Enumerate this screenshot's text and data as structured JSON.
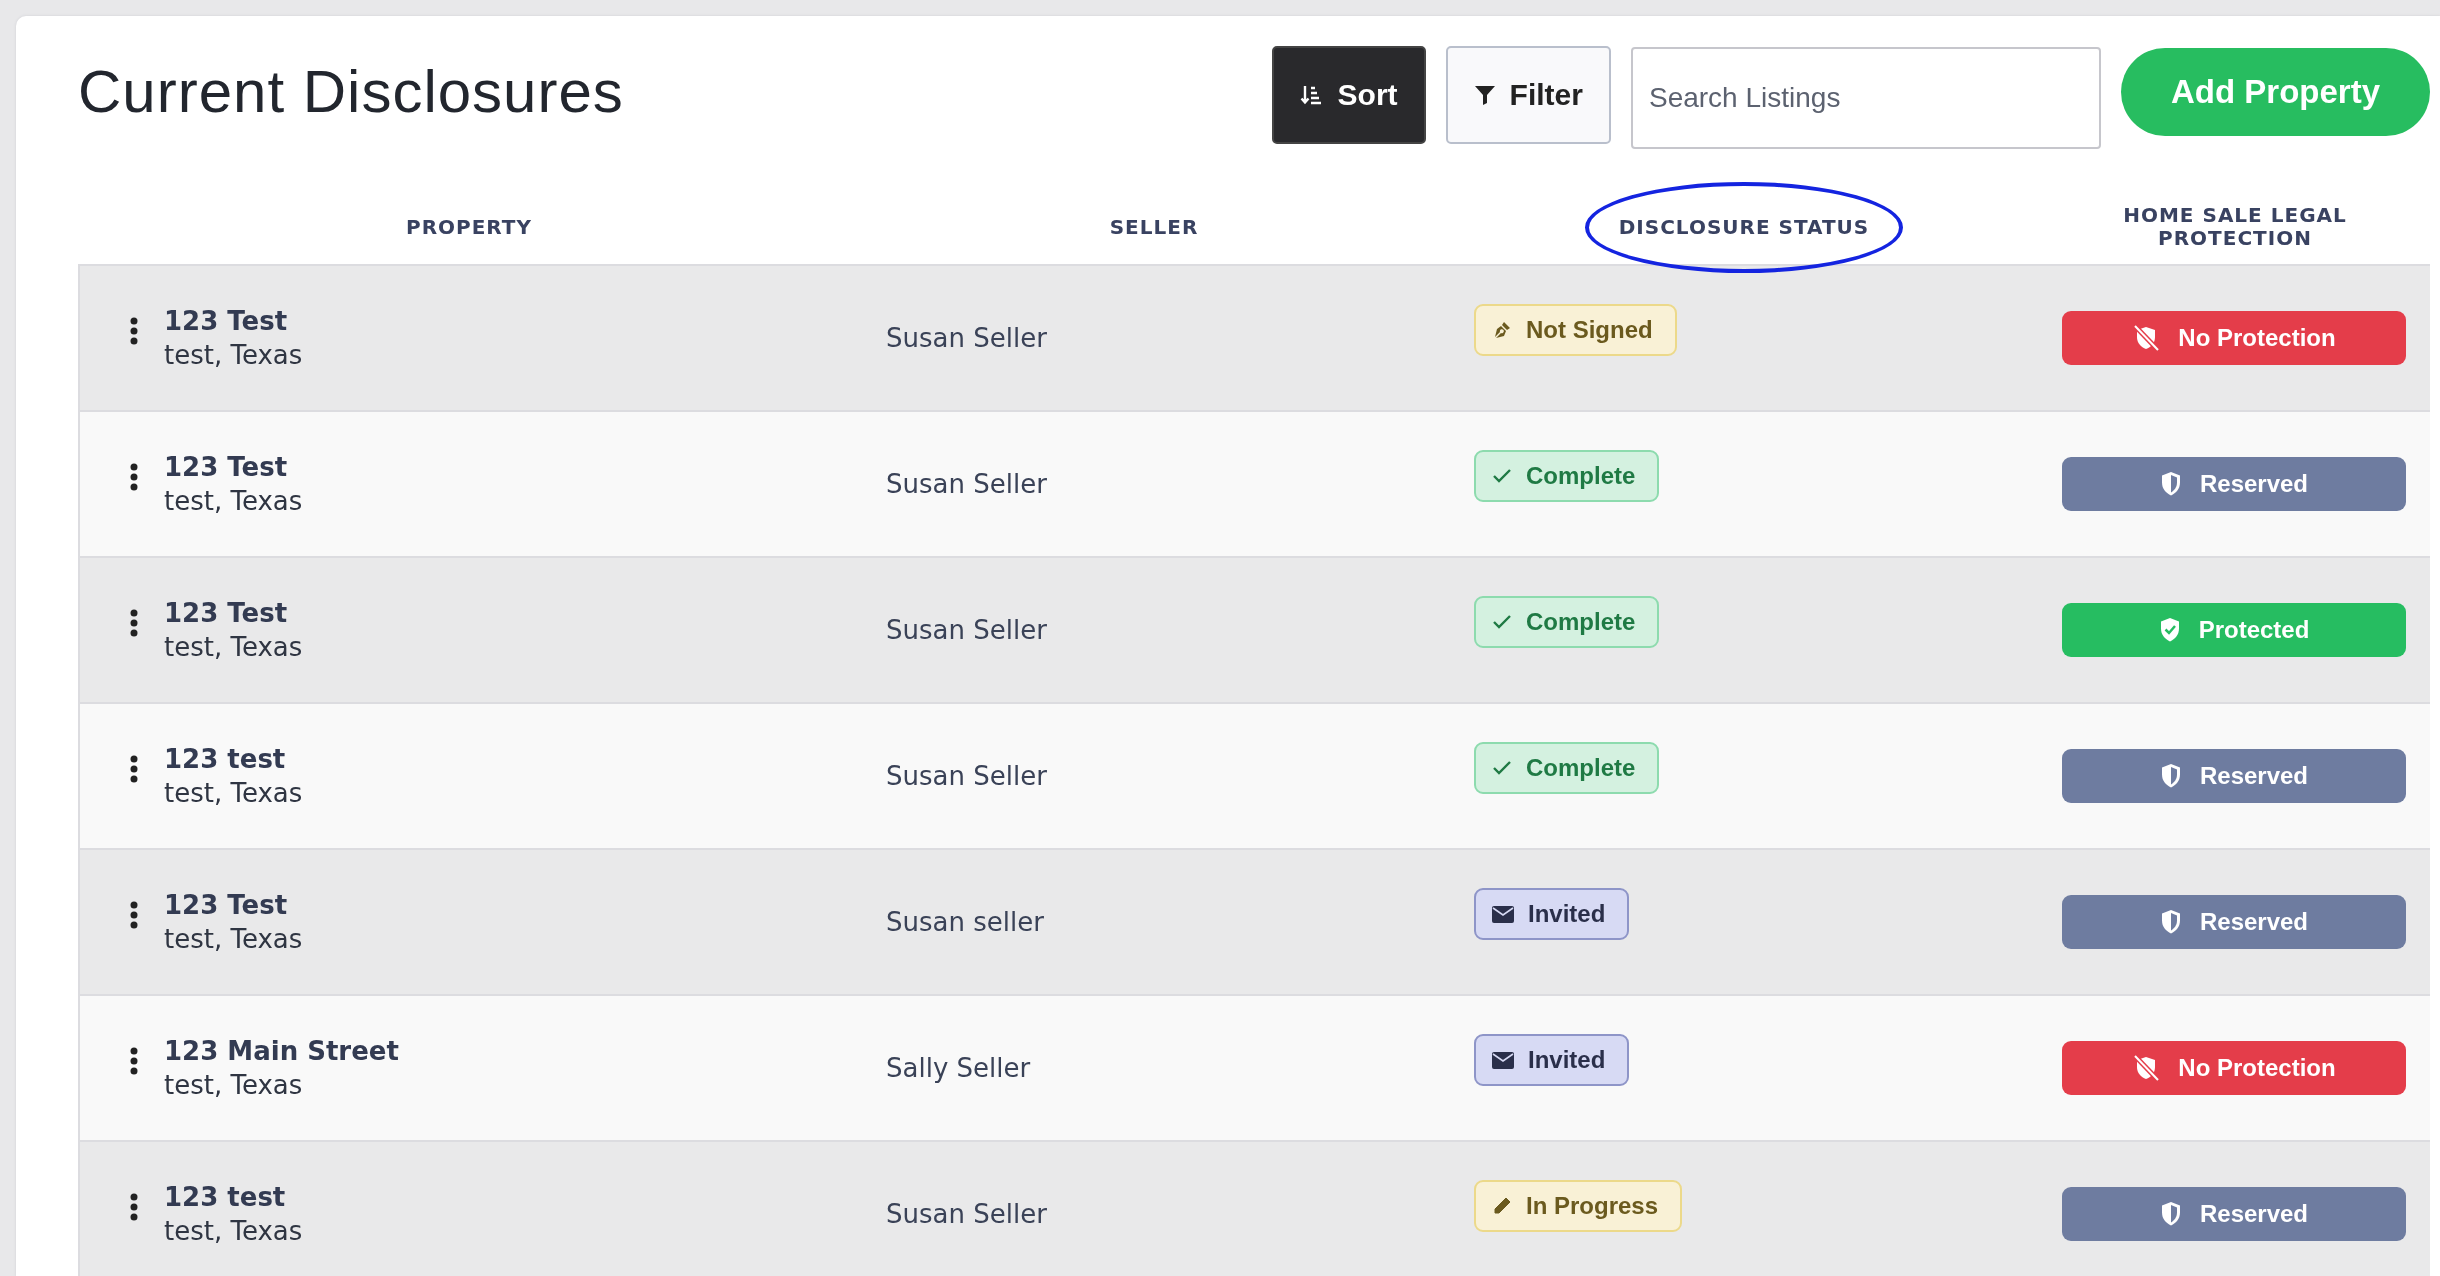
{
  "title": "Current Disclosures",
  "toolbar": {
    "sort": "Sort",
    "filter": "Filter",
    "search": {
      "placeholder": "Search Listings"
    },
    "add": "Add Property"
  },
  "columns": [
    {
      "label": "PROPERTY",
      "circled": false
    },
    {
      "label": "SELLER",
      "circled": false
    },
    {
      "label": "DISCLOSURE STATUS",
      "circled": true
    },
    {
      "label": "HOME SALE LEGAL PROTECTION",
      "circled": false
    }
  ],
  "rows": [
    {
      "address": "123 Test",
      "city": "test, Texas",
      "seller": "Susan Seller",
      "status": {
        "kind": "not_signed",
        "label": "Not Signed"
      },
      "protection": {
        "kind": "none",
        "label": "No Protection"
      }
    },
    {
      "address": "123 Test",
      "city": "test, Texas",
      "seller": "Susan Seller",
      "status": {
        "kind": "complete",
        "label": "Complete"
      },
      "protection": {
        "kind": "reserved",
        "label": "Reserved"
      }
    },
    {
      "address": "123 Test",
      "city": "test, Texas",
      "seller": "Susan Seller",
      "status": {
        "kind": "complete",
        "label": "Complete"
      },
      "protection": {
        "kind": "protected",
        "label": "Protected"
      }
    },
    {
      "address": "123 test",
      "city": "test, Texas",
      "seller": "Susan Seller",
      "status": {
        "kind": "complete",
        "label": "Complete"
      },
      "protection": {
        "kind": "reserved",
        "label": "Reserved"
      }
    },
    {
      "address": "123 Test",
      "city": "test, Texas",
      "seller": "Susan seller",
      "status": {
        "kind": "invited",
        "label": "Invited"
      },
      "protection": {
        "kind": "reserved",
        "label": "Reserved"
      }
    },
    {
      "address": "123 Main Street",
      "city": "test, Texas",
      "seller": "Sally Seller",
      "status": {
        "kind": "invited",
        "label": "Invited"
      },
      "protection": {
        "kind": "none",
        "label": "No Protection"
      }
    },
    {
      "address": "123 test",
      "city": "test, Texas",
      "seller": "Susan Seller",
      "status": {
        "kind": "in_progress",
        "label": "In Progress"
      },
      "protection": {
        "kind": "reserved",
        "label": "Reserved"
      }
    }
  ]
}
